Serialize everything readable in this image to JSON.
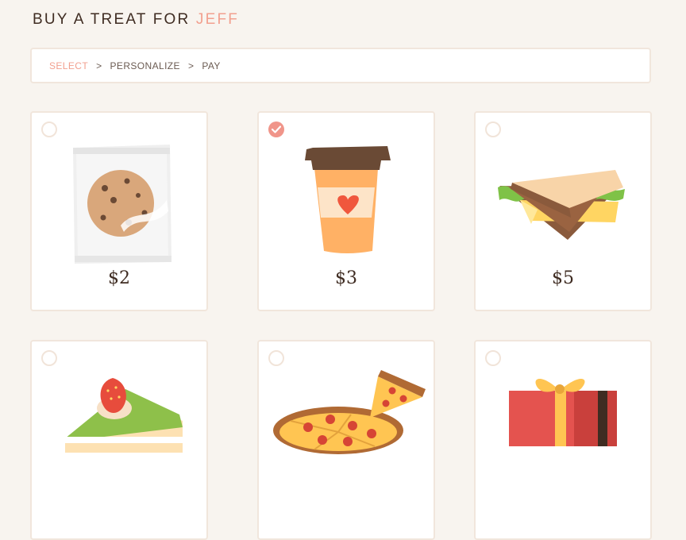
{
  "header": {
    "prefix": "BUY A TREAT FOR ",
    "name": "JEFF"
  },
  "steps": [
    "SELECT",
    "PERSONALIZE",
    "PAY"
  ],
  "step_separator": ">",
  "colors": {
    "accent": "#f2a08f",
    "text": "#3f2c22",
    "background": "#f8f4ef",
    "border": "#f1e6dc",
    "check": "#f0958a"
  },
  "treats": [
    {
      "item": "cookie",
      "price": "$2",
      "selected": false
    },
    {
      "item": "coffee",
      "price": "$3",
      "selected": true
    },
    {
      "item": "sandwich",
      "price": "$5",
      "selected": false
    },
    {
      "item": "cake",
      "price": "",
      "selected": false
    },
    {
      "item": "pizza",
      "price": "",
      "selected": false
    },
    {
      "item": "gift",
      "price": "",
      "selected": false
    }
  ]
}
